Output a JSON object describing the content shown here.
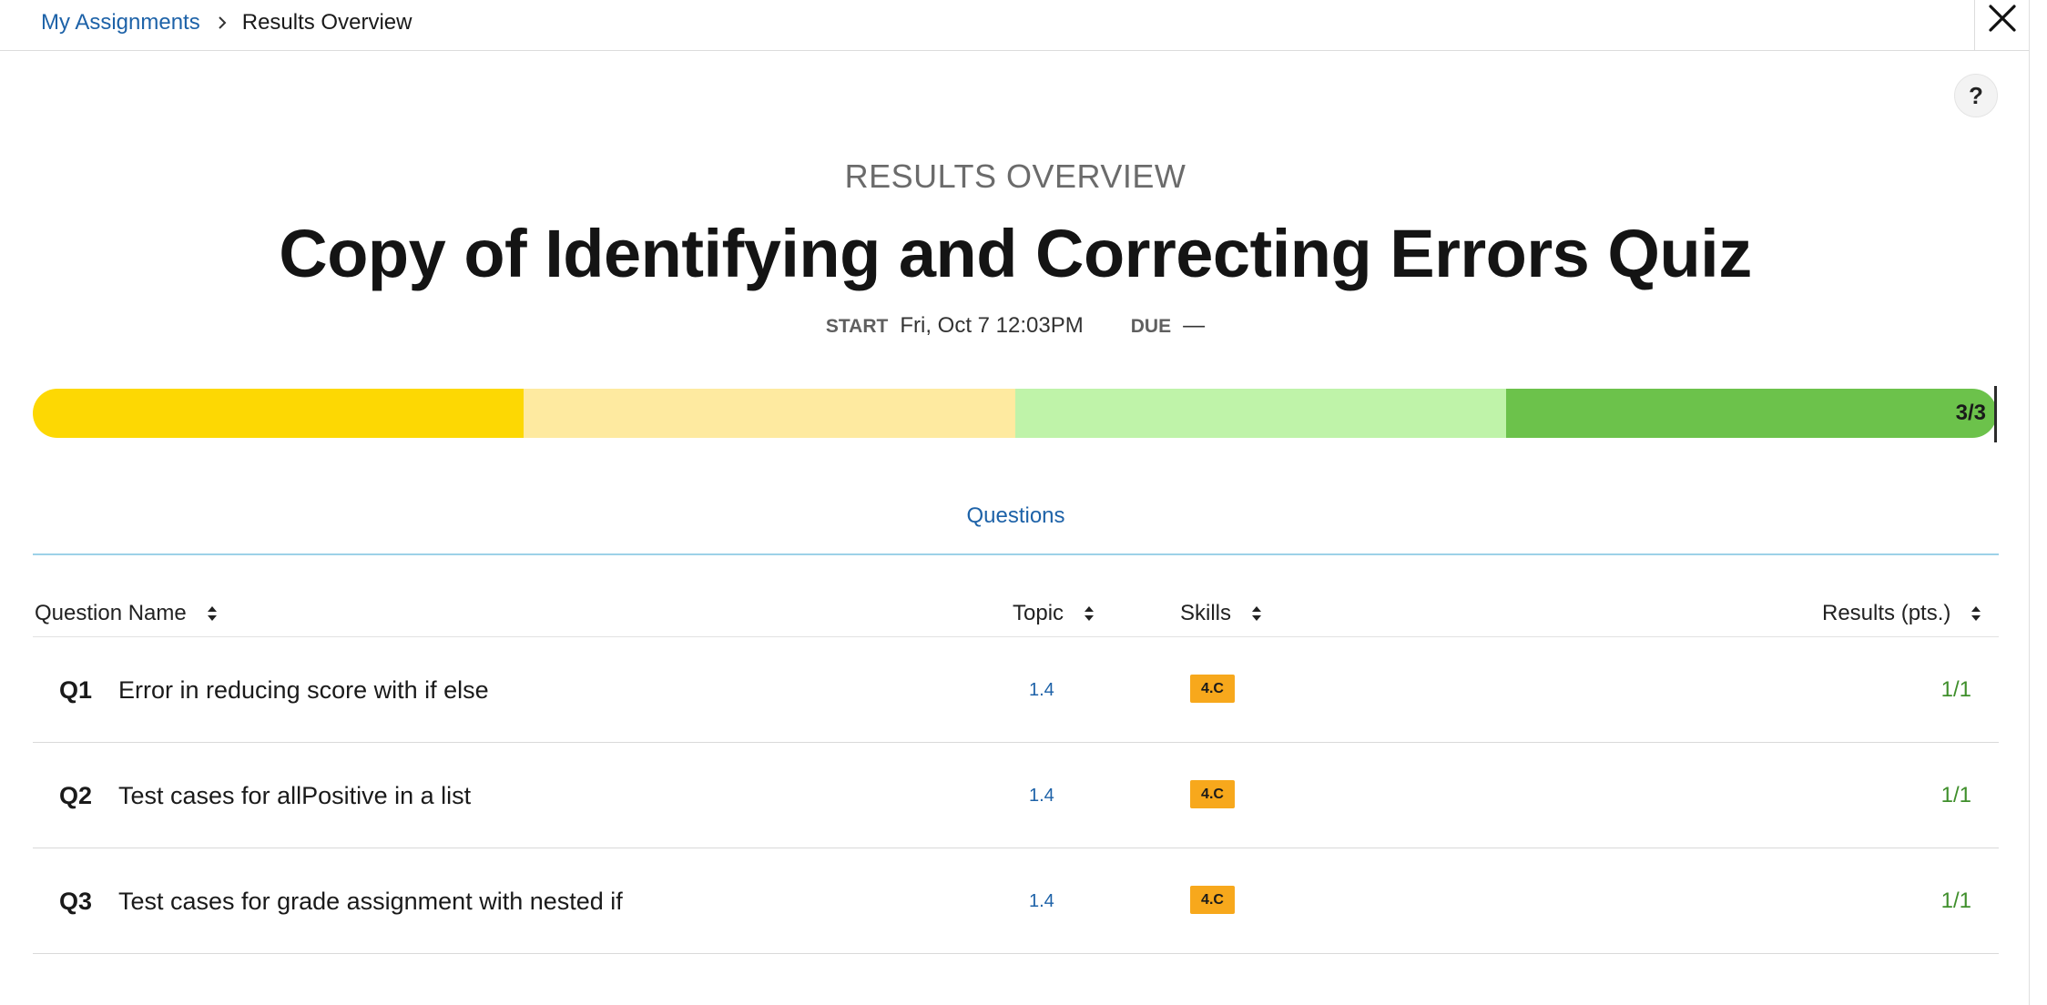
{
  "breadcrumb": {
    "link": "My Assignments",
    "current": "Results Overview"
  },
  "help": {
    "label": "?"
  },
  "header": {
    "overview_label": "RESULTS OVERVIEW",
    "title": "Copy of Identifying and Correcting Errors Quiz",
    "start_key": "START",
    "start_value": "Fri, Oct 7 12:03PM",
    "due_key": "DUE",
    "due_value": "—"
  },
  "progress": {
    "label": "3/3",
    "score": 3,
    "total": 3,
    "segment_colors": [
      "#fdd803",
      "#feeaa0",
      "#bff3a9",
      "#6cc24b"
    ]
  },
  "tabs": [
    {
      "label": "Questions",
      "active": true
    }
  ],
  "table": {
    "columns": {
      "name": "Question Name",
      "topic": "Topic",
      "skills": "Skills",
      "results": "Results (pts.)"
    },
    "rows": [
      {
        "num": "Q1",
        "name": "Error in reducing score with if else",
        "topic": "1.4",
        "skill": "4.C",
        "result": "1/1"
      },
      {
        "num": "Q2",
        "name": "Test cases for allPositive in a list",
        "topic": "1.4",
        "skill": "4.C",
        "result": "1/1"
      },
      {
        "num": "Q3",
        "name": "Test cases for grade assignment with nested if",
        "topic": "1.4",
        "skill": "4.C",
        "result": "1/1"
      }
    ]
  },
  "colors": {
    "link": "#1d62a8",
    "result_green": "#3f8f2b",
    "skill_badge": "#f7a81c",
    "tab_underline": "#9dd2e8"
  }
}
